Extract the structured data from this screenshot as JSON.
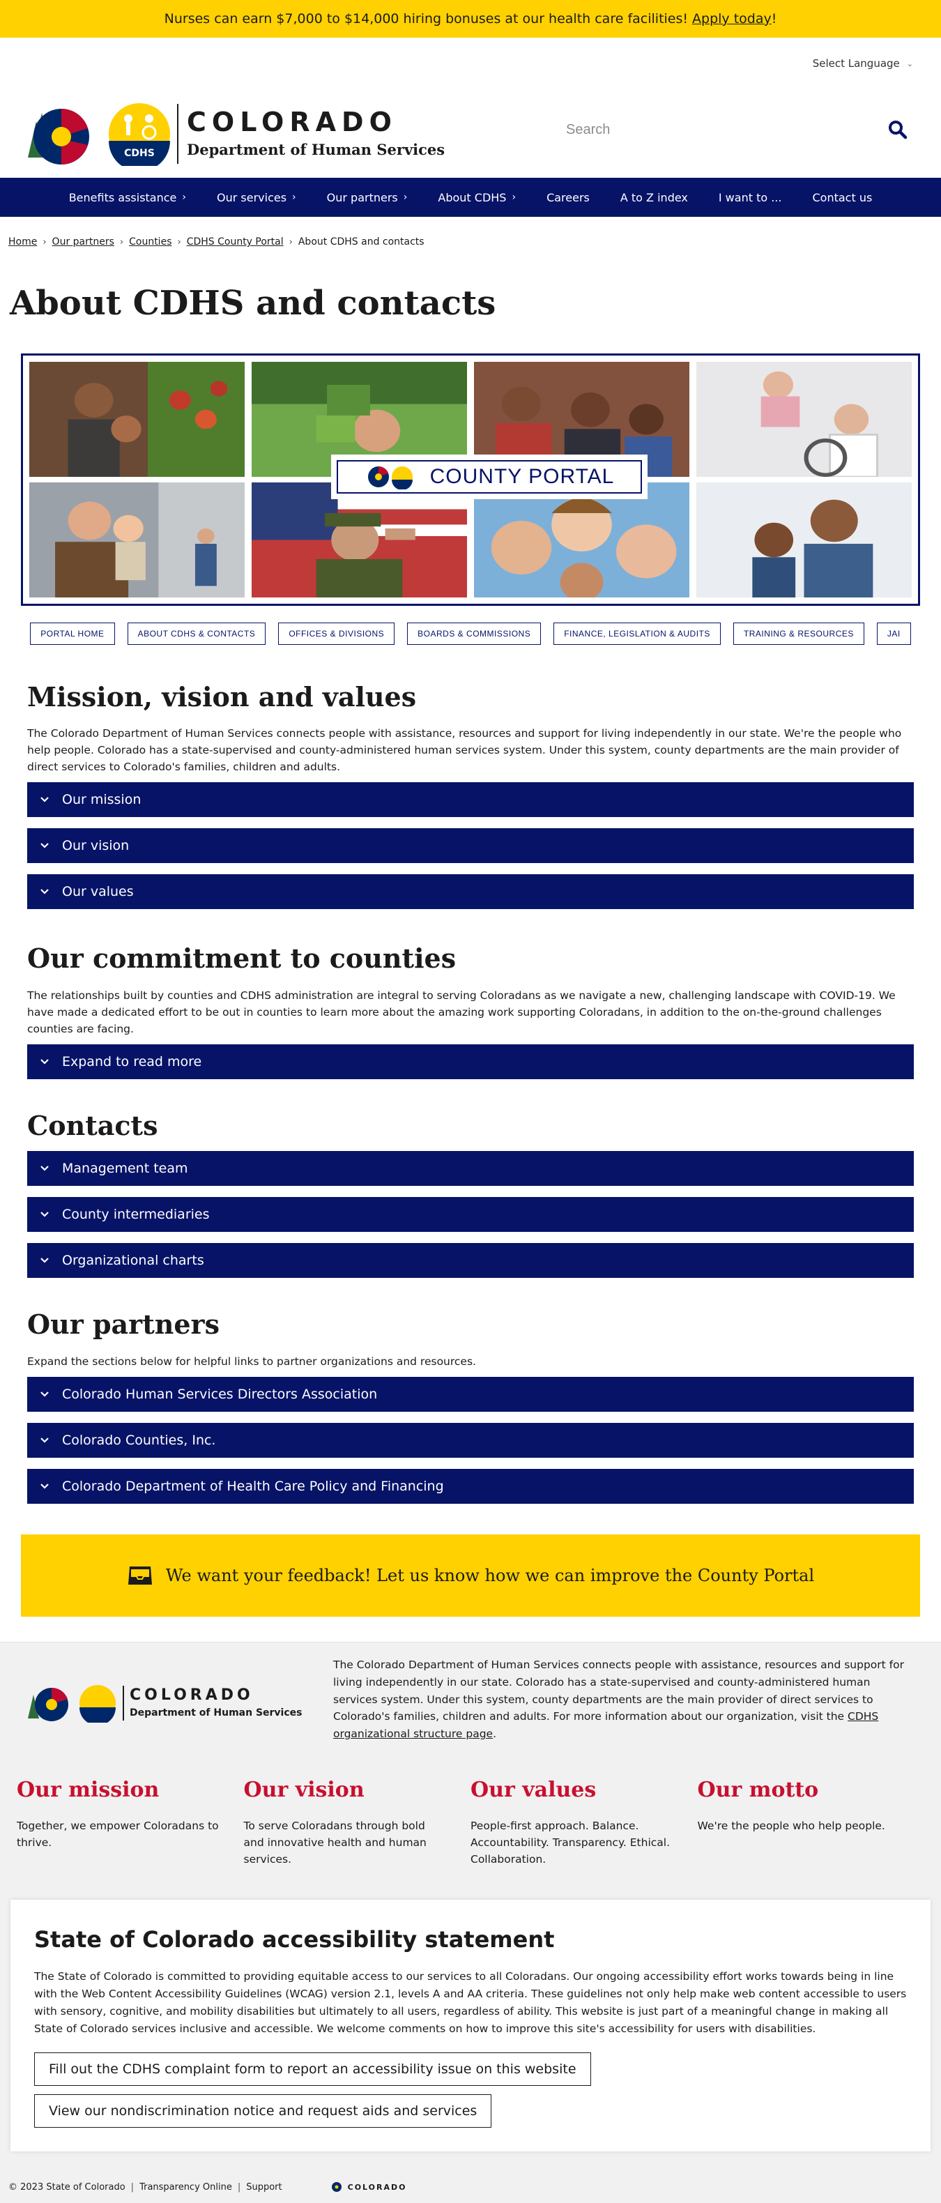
{
  "alert": {
    "text": "Nurses can earn $7,000 to $14,000 hiring bonuses at our health care facilities!",
    "link": "Apply today",
    "suffix": "!",
    "color": "#ffd100"
  },
  "language": {
    "label": "Select Language"
  },
  "header": {
    "logo_state": "COLORADO",
    "logo_dept": "Department of Human Services",
    "logo_badge": "CDHS",
    "search_placeholder": "Search"
  },
  "nav": {
    "items": [
      {
        "label": "Benefits assistance",
        "caret": "›"
      },
      {
        "label": "Our services",
        "caret": "›"
      },
      {
        "label": "Our partners",
        "caret": "›"
      },
      {
        "label": "About CDHS",
        "caret": "›"
      },
      {
        "label": "Careers"
      },
      {
        "label": "A to Z index"
      },
      {
        "label": "I want to ..."
      },
      {
        "label": "Contact us"
      }
    ],
    "color": "#061367"
  },
  "breadcrumb": {
    "items": [
      "Home",
      "Our partners",
      "Counties",
      "CDHS County Portal"
    ],
    "current": "About CDHS and contacts",
    "sep": "›"
  },
  "page_title": "About CDHS and contacts",
  "banner": {
    "label": "COUNTY PORTAL",
    "photos": [
      "family-grocery-photo",
      "child-upside-down-photo",
      "family-fence-photo",
      "grandparent-baby-photo",
      "father-son-photo",
      "veteran-salute-photo",
      "children-smiling-photo",
      "father-child-photo"
    ]
  },
  "subnav": [
    "Portal home",
    "About CDHS & contacts",
    "Offices & divisions",
    "Boards & commissions",
    "Finance, legislation & audits",
    "Training & resources",
    "JAI"
  ],
  "mission": {
    "title": "Mission, vision and values",
    "text": "The Colorado Department of Human Services connects people with assistance, resources and support for living independently in our state. We're the people who help people. Colorado has a state-supervised and county-administered human services system. Under this system, county departments are the main provider of direct services to Colorado's families, children and adults.",
    "accordions": [
      "Our mission",
      "Our vision",
      "Our values"
    ]
  },
  "commitment": {
    "title": "Our commitment to counties",
    "text": "The relationships built by counties and CDHS administration are integral to serving Coloradans as we navigate a new, challenging landscape with COVID-19. We have made a dedicated effort to be out in counties to learn more about the amazing work supporting Coloradans, in addition to the on-the-ground challenges counties are facing.",
    "accordions": [
      "Expand to read more"
    ]
  },
  "contacts": {
    "title": "Contacts",
    "accordions": [
      "Management team",
      "County intermediaries",
      "Organizational charts"
    ]
  },
  "partners": {
    "title": "Our partners",
    "text": "Expand the sections below for helpful links to partner organizations and resources.",
    "accordions": [
      "Colorado Human Services Directors Association",
      "Colorado Counties, Inc.",
      "Colorado Department of Health Care Policy and Financing"
    ]
  },
  "feedback": {
    "text": "We want your feedback! Let us know how we can improve the County Portal"
  },
  "footer": {
    "about": "The Colorado Department of Human Services connects people with assistance, resources and support for living independently in our state. Colorado has a state-supervised and county-administered human services system. Under this system, county departments are the main provider of direct services to Colorado's families, children and adults. For more information about our organization, visit the",
    "about_link": "CDHS organizational structure page",
    "about_end": ".",
    "pillars": [
      {
        "title": "Our mission",
        "text": "Together, we empower Coloradans to thrive."
      },
      {
        "title": "Our vision",
        "text": "To serve Coloradans through bold and innovative health and human services."
      },
      {
        "title": "Our values",
        "text": "People-first approach. Balance. Accountability. Transparency. Ethical. Collaboration."
      },
      {
        "title": "Our motto",
        "text": "We're the people who help people."
      }
    ],
    "accent": "#c8102e"
  },
  "accessibility": {
    "title": "State of Colorado accessibility statement",
    "text": "The State of Colorado is committed to providing equitable access to our services to all Coloradans. Our ongoing accessibility effort works towards being in line with the Web Content Accessibility Guidelines (WCAG) version 2.1, levels A and AA criteria. These guidelines not only help make web content accessible to users with sensory, cognitive, and mobility disabilities but ultimately to all users, regardless of ability. This website is just part of a meaningful change in making all State of Colorado services inclusive and accessible. We welcome comments on how to improve this site's accessibility for users with disabilities.",
    "buttons": [
      "Fill out the CDHS complaint form to report an accessibility issue on this website",
      "View our nondiscrimination notice and request aids and services"
    ]
  },
  "bottom": {
    "copyright": "© 2023 State of Colorado",
    "links": [
      "Transparency Online",
      "Support"
    ],
    "logo": "COLORADO"
  }
}
